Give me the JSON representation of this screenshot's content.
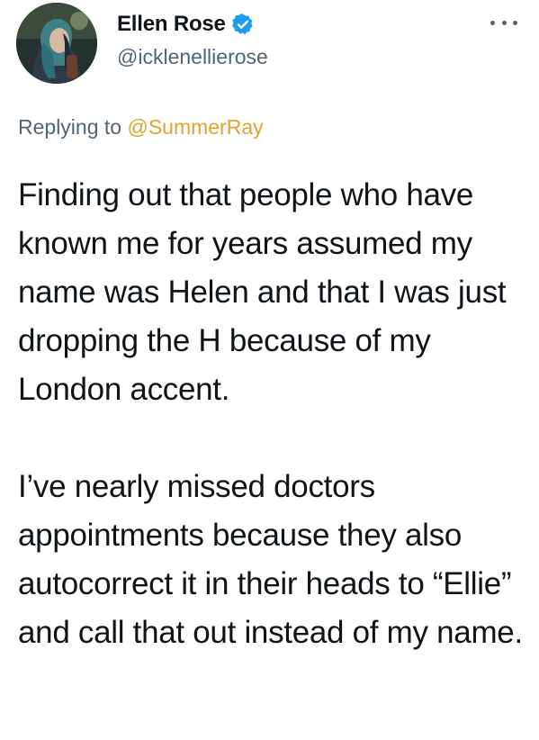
{
  "tweet": {
    "author": {
      "display_name": "Ellen Rose",
      "handle": "@icklenellierose",
      "verified": true,
      "verified_color": "#1d9bf0"
    },
    "reply": {
      "prefix": "Replying to",
      "mention": "@SummerRay",
      "mention_color": "#e0a32e"
    },
    "paragraphs": [
      "Finding out that people who have known me for years assumed my name was Helen and that I was just dropping the H because of my London accent.",
      "I’ve nearly missed doctors appointments because they also autocorrect it in their heads to “Ellie” and call that out instead of my name."
    ],
    "icons": {
      "avatar": "avatar-photo",
      "verified": "verified-badge-icon",
      "more": "more-options-icon"
    }
  }
}
